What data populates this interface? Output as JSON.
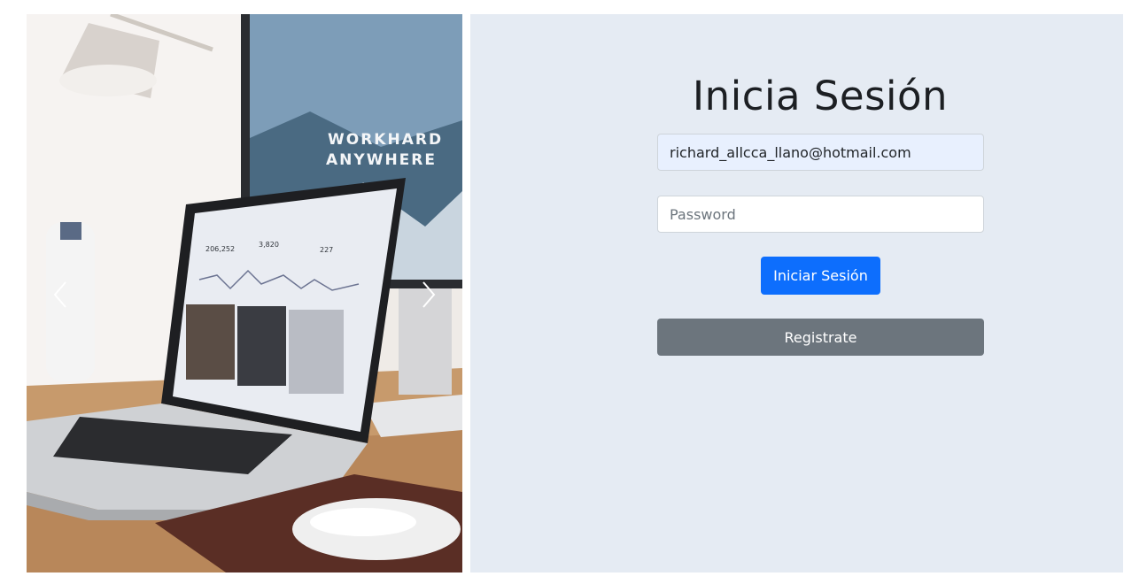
{
  "carousel": {
    "image_description": "",
    "prev_icon": "chevron-left-icon",
    "next_icon": "chevron-right-icon",
    "poster_line1": "WORKHARD",
    "poster_line2": "ANYWHERE",
    "stat1": "206,252",
    "stat2": "3,820",
    "stat3": "227"
  },
  "login": {
    "title": "Inicia Sesión",
    "email_value": "richard_allcca_llano@hotmail.com",
    "password_placeholder": "Password",
    "login_button": "Iniciar Sesión",
    "register_button": "Registrate"
  },
  "colors": {
    "panel_bg": "#e5ebf3",
    "primary": "#0d6efd",
    "secondary": "#6c757d",
    "autofill": "#e8f0fe"
  }
}
